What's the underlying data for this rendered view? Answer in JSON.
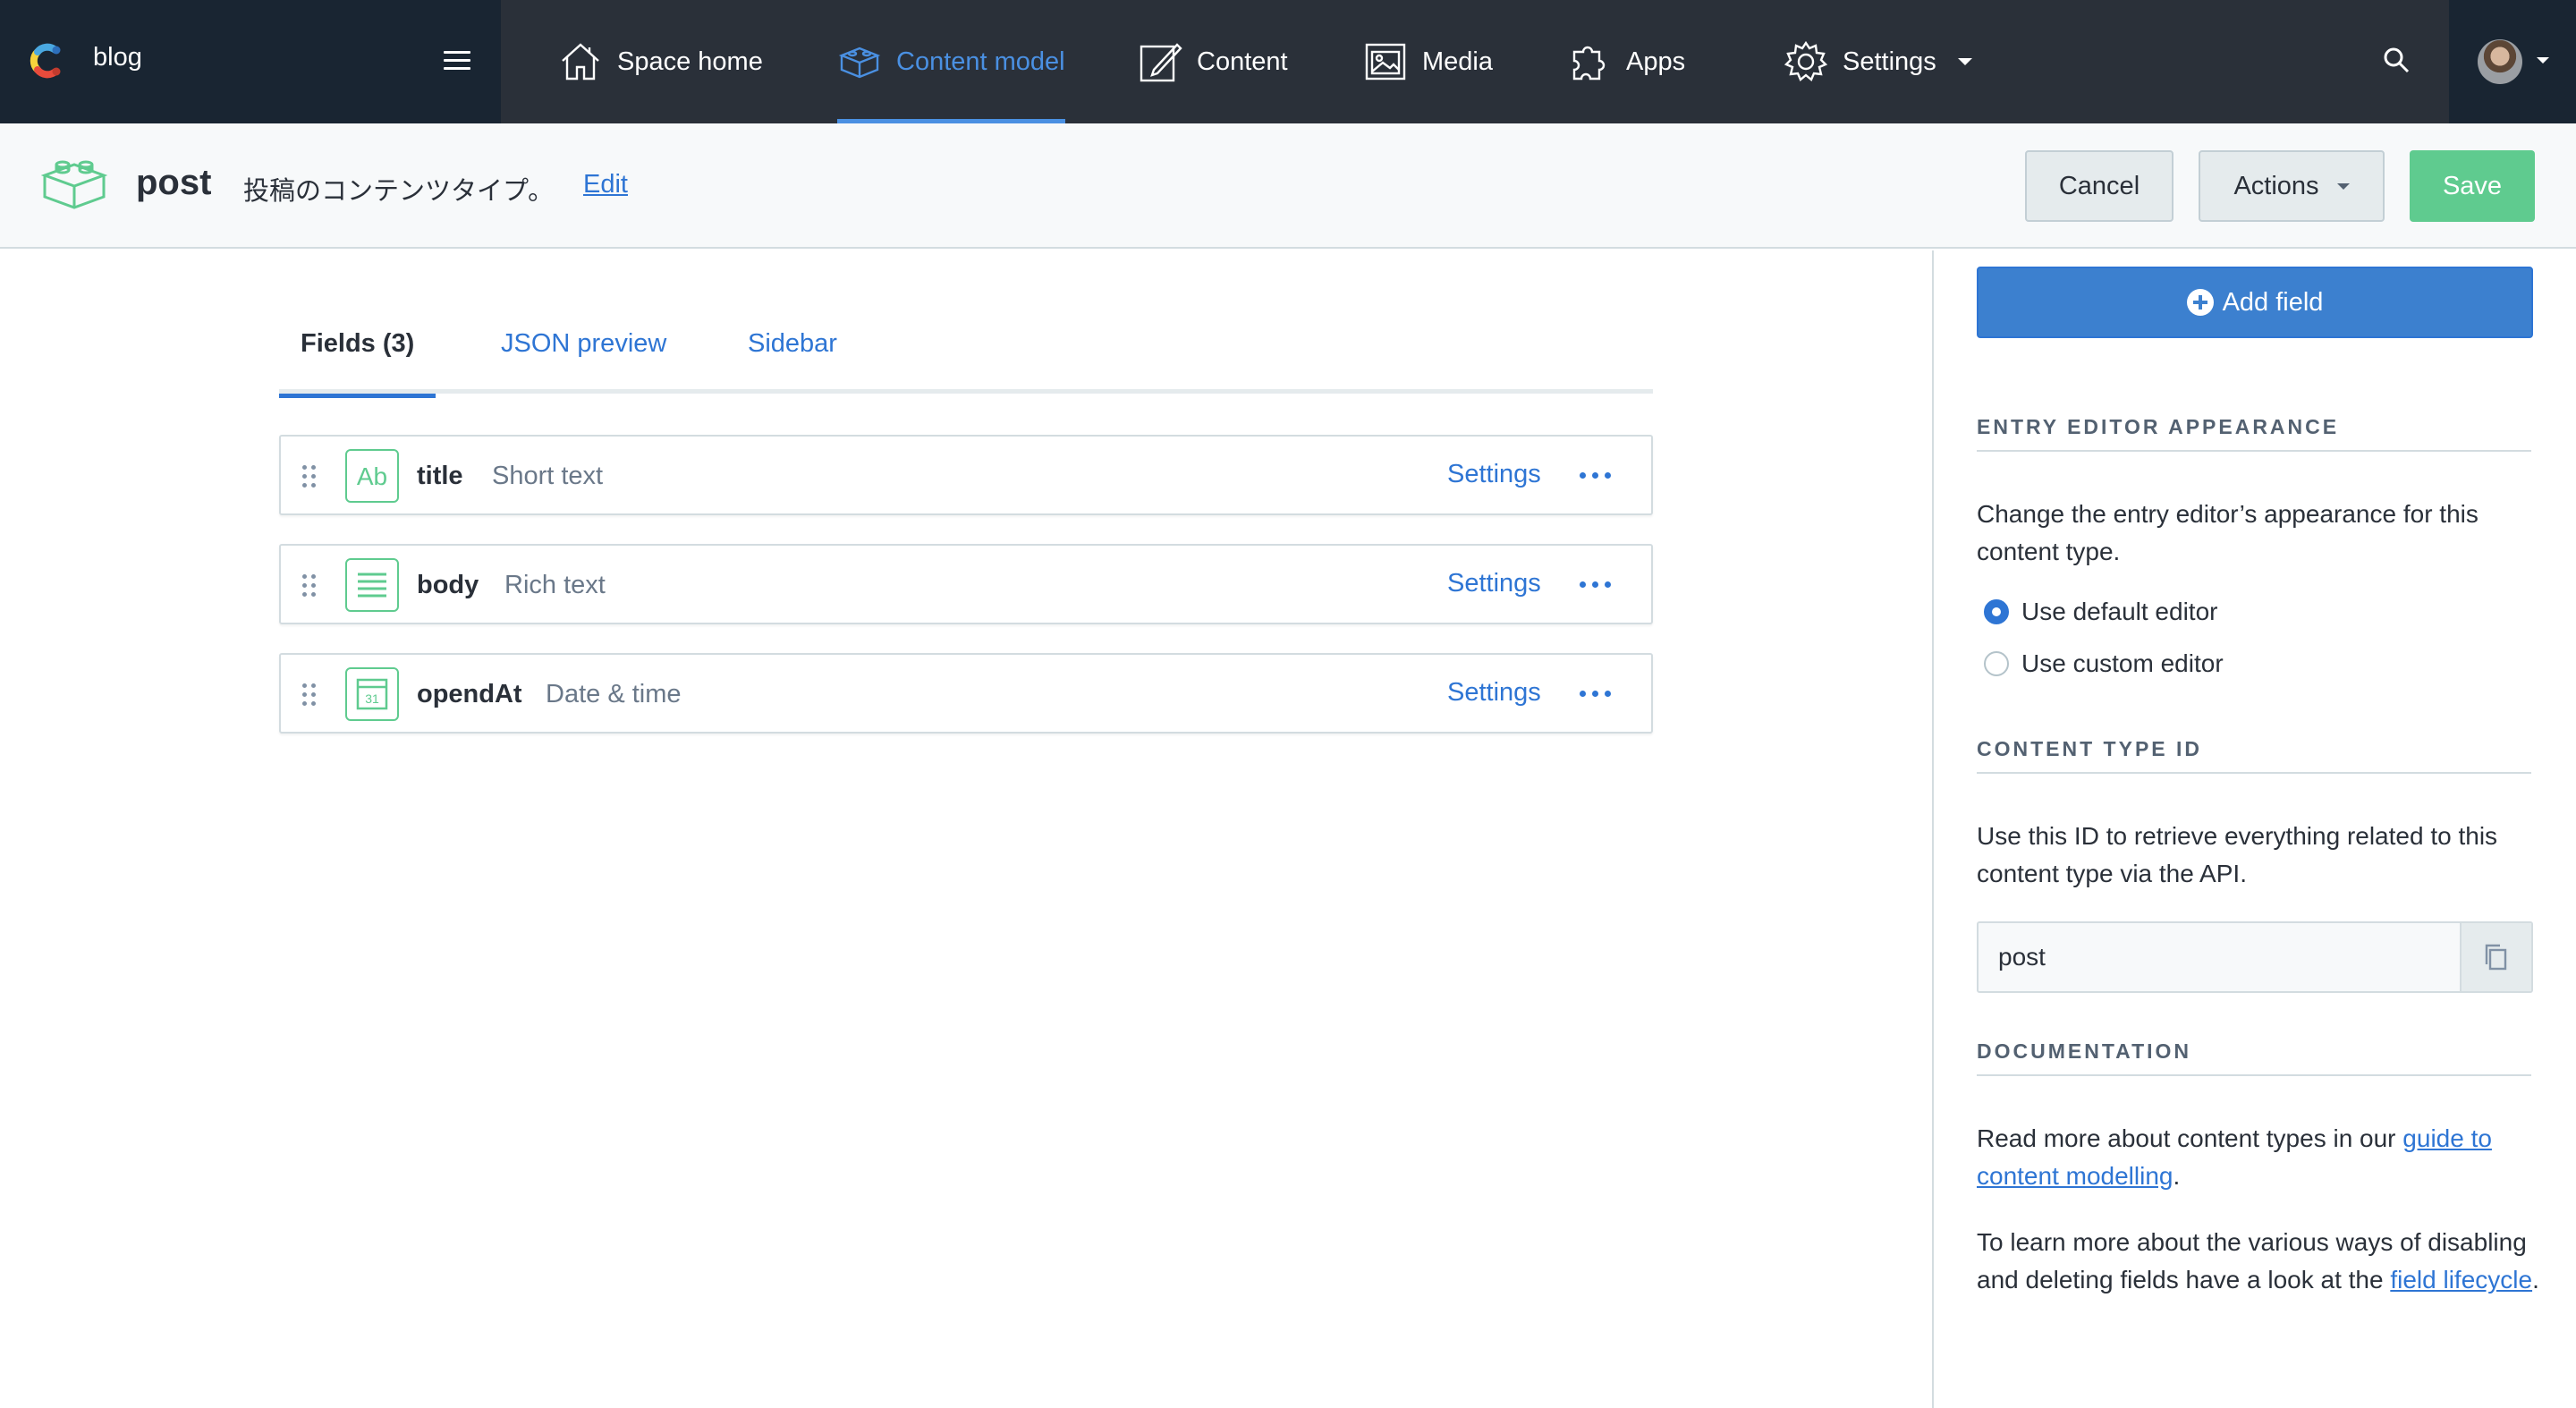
{
  "nav": {
    "space_name": "blog",
    "items": [
      {
        "label": "Space home",
        "icon": "home-icon"
      },
      {
        "label": "Content model",
        "icon": "content-model-icon",
        "active": true
      },
      {
        "label": "Content",
        "icon": "content-edit-icon"
      },
      {
        "label": "Media",
        "icon": "media-icon"
      },
      {
        "label": "Apps",
        "icon": "apps-puzzle-icon"
      },
      {
        "label": "Settings",
        "icon": "gear-icon"
      }
    ]
  },
  "header": {
    "name": "post",
    "description": "投稿のコンテンツタイプ。",
    "edit_label": "Edit",
    "cancel_label": "Cancel",
    "actions_label": "Actions",
    "save_label": "Save"
  },
  "tabs": [
    {
      "label": "Fields (3)",
      "active": true
    },
    {
      "label": "JSON preview"
    },
    {
      "label": "Sidebar"
    }
  ],
  "fields": [
    {
      "name": "title",
      "type": "Short text",
      "icon": "short-text-icon",
      "settings_label": "Settings"
    },
    {
      "name": "body",
      "type": "Rich text",
      "icon": "rich-text-icon",
      "settings_label": "Settings"
    },
    {
      "name": "opendAt",
      "type": "Date & time",
      "icon": "calendar-icon",
      "icon_text": "31",
      "settings_label": "Settings"
    }
  ],
  "sidebar": {
    "add_field_label": "Add field",
    "appearance": {
      "heading": "ENTRY EDITOR APPEARANCE",
      "text": "Change the entry editor’s appearance for this content type.",
      "options": [
        {
          "label": "Use default editor",
          "checked": true
        },
        {
          "label": "Use custom editor",
          "checked": false
        }
      ]
    },
    "content_type_id": {
      "heading": "CONTENT TYPE ID",
      "text": "Use this ID to retrieve everything related to this content type via the API.",
      "value": "post"
    },
    "documentation": {
      "heading": "DOCUMENTATION",
      "text1_before": "Read more about content types in our ",
      "text1_link": "guide to content modelling",
      "text1_after": ".",
      "text2_before": "To learn more about the various ways of disabling and deleting fields have a look at the ",
      "text2_link": "field lifecycle",
      "text2_after": "."
    }
  },
  "colors": {
    "nav_bg": "#2a3039",
    "nav_dark": "#192532",
    "accent_blue": "#2e75d4",
    "save_green": "#5fcb8f"
  }
}
